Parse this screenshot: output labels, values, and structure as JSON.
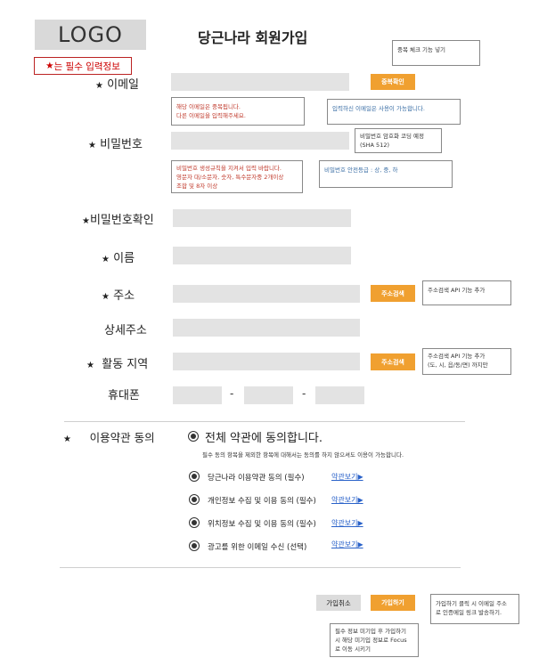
{
  "header": {
    "logo": "LOGO",
    "title": "당근나라 회원가입"
  },
  "required_notice": {
    "star": "★",
    "text": "는 필수 입력정보"
  },
  "star": "★",
  "fields": {
    "email": "이메일",
    "password": "비밀번호",
    "password_confirm": "비밀번호확인",
    "name": "이름",
    "address": "주소",
    "address_detail": "상세주소",
    "region": "활동 지역",
    "phone": "휴대폰"
  },
  "buttons": {
    "dup_check": "중복확인",
    "addr_search": "주소검색",
    "region_search": "주소검색",
    "cancel": "가입취소",
    "join": "가입하기"
  },
  "notes": {
    "dup_feature": "중복 체크 기능 넣기",
    "email_dup_line1": "해당 이메일은 중복됩니다.",
    "email_dup_line2": "다른 이메일을 입력해주세요.",
    "email_ok": "입력하신 이메일은 사용이 가능합니다.",
    "pw_encrypt_line1": "비밀번호 암호화 코딩 예정",
    "pw_encrypt_line2": "(SHA 512)",
    "pw_rule_line1": "비밀번호 생성규칙을 지켜서 입력 바랍니다.",
    "pw_rule_line2": "영문자 대/소문자, 숫자, 특수문자중 2개이상",
    "pw_rule_line3": "조합 및 8자 이상",
    "pw_strength": "비밀번호 안전등급 : 상, 중, 하",
    "addr_api": "주소검색 API 기능 추가",
    "region_api_line1": "주소검색 API 기능 추가",
    "region_api_line2": "(도, 시, 읍/동/면) 까지만",
    "join_note_line1": "가입하기 클릭 시 이메일 주소",
    "join_note_line2": "로 인증메일 링크 발송하기.",
    "focus_note_line1": "필수 정보 미기입 후 가입하기",
    "focus_note_line2": "시 해당 미기입 정보로 Focus",
    "focus_note_line3": "로 이동 시키기"
  },
  "phone_sep": "-",
  "terms": {
    "label": "이용약관 동의",
    "all": "전체 약관에 동의합니다.",
    "desc": "필수 동의 항목을 제외한 항목에 대해서는 동의를 하지 않으셔도 이용이 가능합니다.",
    "items": [
      {
        "label": "당근나라 이용약관 동의 (필수)",
        "link": "약관보기▶"
      },
      {
        "label": "개인정보 수집 및 이용 동의 (필수)",
        "link": "약관보기▶"
      },
      {
        "label": "위치정보 수집 및 이용 동의 (필수)",
        "link": "약관보기▶"
      },
      {
        "label": "광고를 위한 이메일 수신 (선택)",
        "link": "약관보기▶"
      }
    ]
  },
  "colors": {
    "accent": "#f0a030",
    "required": "#cc0000",
    "link": "#2a62c9",
    "input_bg": "#e3e3e3"
  }
}
